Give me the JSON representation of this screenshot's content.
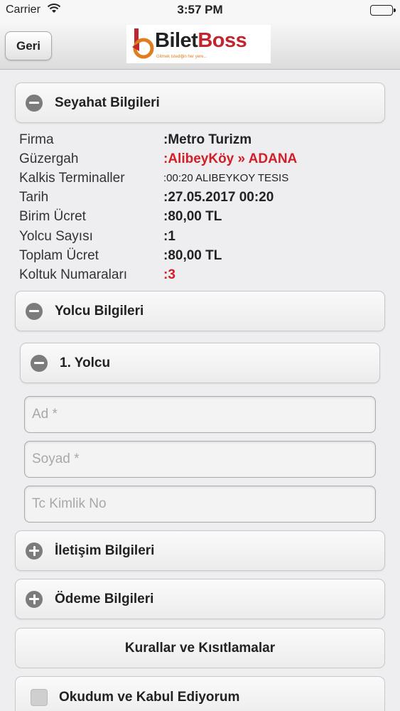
{
  "status_bar": {
    "carrier": "Carrier",
    "time": "3:57 PM"
  },
  "header": {
    "back_label": "Geri",
    "logo": {
      "text_part1": "Bilet",
      "text_part2": "Boss",
      "slogan": "Gitmek istediğin her yere..."
    }
  },
  "sections": {
    "trip": {
      "title": "Seyahat Bilgileri"
    },
    "passenger": {
      "title": "Yolcu Bilgileri"
    },
    "passenger1": {
      "title": "1. Yolcu"
    },
    "contact": {
      "title": "İletişim Bilgileri"
    },
    "payment": {
      "title": "Ödeme Bilgileri"
    }
  },
  "trip_info": [
    {
      "label": "Firma",
      "value": ":Metro Turizm"
    },
    {
      "label": "Güzergah",
      "value": ":AlibeyKöy » ADANA"
    },
    {
      "label": "Kalkis Terminaller",
      "value": ":00:20 ALIBEYKOY TESIS"
    },
    {
      "label": "Tarih",
      "value": ":27.05.2017 00:20"
    },
    {
      "label": "Birim Ücret",
      "value": ":80,00 TL"
    },
    {
      "label": "Yolcu Sayısı",
      "value": ":1"
    },
    {
      "label": "Toplam Ücret",
      "value": ":80,00 TL"
    },
    {
      "label": "Koltuk Numaraları",
      "value": ":3"
    }
  ],
  "form": {
    "first_name_placeholder": "Ad *",
    "last_name_placeholder": "Soyad *",
    "tc_placeholder": "Tc Kimlik No"
  },
  "rules_button": "Kurallar ve Kısıtlamalar",
  "agree_label": "Okudum ve Kabul Ediyorum",
  "colors": {
    "accent_red": "#d21e26",
    "logo_orange": "#e07d1f"
  }
}
